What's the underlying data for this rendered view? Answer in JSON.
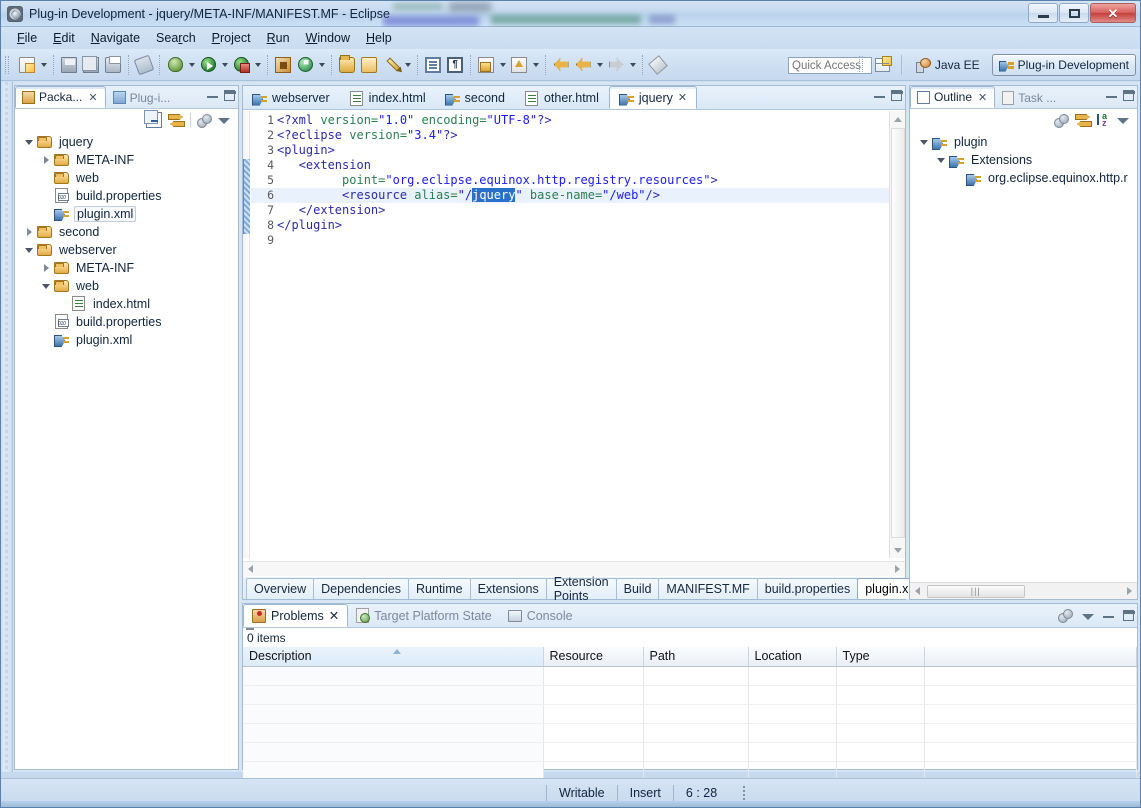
{
  "window": {
    "title": "Plug-in Development - jquery/META-INF/MANIFEST.MF - Eclipse",
    "app_icon": "eclipse-icon",
    "minimize": "minimize-button",
    "maximize": "maximize-button",
    "close": "close-button"
  },
  "menu": {
    "items": [
      {
        "label": "File",
        "mnemonic": "F"
      },
      {
        "label": "Edit",
        "mnemonic": "E"
      },
      {
        "label": "Navigate",
        "mnemonic": "N"
      },
      {
        "label": "Search",
        "mnemonic": "r"
      },
      {
        "label": "Project",
        "mnemonic": "P"
      },
      {
        "label": "Run",
        "mnemonic": "R"
      },
      {
        "label": "Window",
        "mnemonic": "W"
      },
      {
        "label": "Help",
        "mnemonic": "H"
      }
    ]
  },
  "toolbar": {
    "buttons": [
      {
        "name": "new-wizard",
        "icon": "new-document-icon",
        "has_dropdown": true
      },
      {
        "name": "save",
        "icon": "save-icon",
        "has_dropdown": false
      },
      {
        "name": "save-all",
        "icon": "save-all-icon",
        "has_dropdown": false
      },
      {
        "name": "print",
        "icon": "print-icon",
        "has_dropdown": false
      },
      {
        "name": "toggle-mark-occurrences",
        "icon": "mark-occurrences-icon",
        "has_dropdown": false
      },
      {
        "name": "debug",
        "icon": "bug-icon",
        "has_dropdown": true
      },
      {
        "name": "run",
        "icon": "run-icon",
        "has_dropdown": true
      },
      {
        "name": "run-external-tools",
        "icon": "external-tools-icon",
        "has_dropdown": true
      },
      {
        "name": "new-plugin-project",
        "icon": "new-plugin-icon",
        "has_dropdown": false
      },
      {
        "name": "new-target-definition",
        "icon": "target-definition-icon",
        "has_dropdown": true
      },
      {
        "name": "open-type",
        "icon": "open-type-icon",
        "has_dropdown": false
      },
      {
        "name": "open-resource",
        "icon": "open-folder-icon",
        "has_dropdown": false
      },
      {
        "name": "quick-fix",
        "icon": "pencil-icon",
        "has_dropdown": true
      },
      {
        "name": "show-whitespace",
        "icon": "list-box-icon",
        "has_dropdown": false
      },
      {
        "name": "toggle-block-selection",
        "icon": "paragraph-icon",
        "has_dropdown": false
      },
      {
        "name": "next-annotation",
        "icon": "next-annotation-icon",
        "has_dropdown": true
      },
      {
        "name": "previous-annotation",
        "icon": "previous-annotation-icon",
        "has_dropdown": true
      },
      {
        "name": "back-history",
        "icon": "back-arrow-icon",
        "has_dropdown": false
      },
      {
        "name": "back-history-2",
        "icon": "back-arrow-icon",
        "has_dropdown": true
      },
      {
        "name": "forward-history",
        "icon": "forward-arrow-icon",
        "has_dropdown": true
      },
      {
        "name": "ruler",
        "icon": "ruler-icon",
        "has_dropdown": false
      }
    ]
  },
  "quick_access": {
    "placeholder": "Quick Access",
    "value": ""
  },
  "perspectives": {
    "open_perspective_icon": "open-perspective-icon",
    "items": [
      {
        "label": "Java EE",
        "icon": "java-ee-icon",
        "active": false
      },
      {
        "label": "Plug-in Development",
        "icon": "plugin-development-icon",
        "active": true
      }
    ]
  },
  "package_explorer": {
    "tabs": [
      {
        "label": "Packa...",
        "icon": "package-explorer-icon",
        "active": true,
        "closable": true
      },
      {
        "label": "Plug-i...",
        "icon": "plugins-view-icon",
        "active": false,
        "closable": false
      }
    ],
    "toolbar": [
      {
        "name": "collapse-all",
        "icon": "collapse-all-icon"
      },
      {
        "name": "link-with-editor",
        "icon": "link-with-editor-icon"
      },
      {
        "name": "view-menu-balls",
        "icon": "focus-on-active-task-icon"
      },
      {
        "name": "view-menu",
        "icon": "view-menu-icon"
      }
    ],
    "tree": [
      {
        "label": "jquery",
        "icon": "folder-icon",
        "indent": 0,
        "twisty": "expanded",
        "selected": false
      },
      {
        "label": "META-INF",
        "icon": "folder-icon",
        "indent": 1,
        "twisty": "collapsed",
        "selected": false
      },
      {
        "label": "web",
        "icon": "folder-icon",
        "indent": 1,
        "twisty": "none",
        "selected": false
      },
      {
        "label": "build.properties",
        "icon": "properties-file-icon",
        "indent": 1,
        "twisty": "none",
        "selected": false
      },
      {
        "label": "plugin.xml",
        "icon": "plugin-file-icon",
        "indent": 1,
        "twisty": "none",
        "selected": true
      },
      {
        "label": "second",
        "icon": "folder-icon",
        "indent": 0,
        "twisty": "collapsed",
        "selected": false
      },
      {
        "label": "webserver",
        "icon": "folder-icon",
        "indent": 0,
        "twisty": "expanded",
        "selected": false
      },
      {
        "label": "META-INF",
        "icon": "folder-icon",
        "indent": 1,
        "twisty": "collapsed",
        "selected": false
      },
      {
        "label": "web",
        "icon": "folder-icon",
        "indent": 1,
        "twisty": "expanded",
        "selected": false
      },
      {
        "label": "index.html",
        "icon": "html-file-icon",
        "indent": 2,
        "twisty": "none",
        "selected": false
      },
      {
        "label": "build.properties",
        "icon": "properties-file-icon",
        "indent": 1,
        "twisty": "none",
        "selected": false
      },
      {
        "label": "plugin.xml",
        "icon": "plugin-file-icon",
        "indent": 1,
        "twisty": "none",
        "selected": false
      }
    ]
  },
  "editor": {
    "tabs": [
      {
        "label": "webserver",
        "icon": "plugin-file-icon",
        "active": false,
        "closable": false
      },
      {
        "label": "index.html",
        "icon": "html-file-icon",
        "active": false,
        "closable": false
      },
      {
        "label": "second",
        "icon": "plugin-file-icon",
        "active": false,
        "closable": false
      },
      {
        "label": "other.html",
        "icon": "html-file-icon",
        "active": false,
        "closable": false
      },
      {
        "label": "jquery",
        "icon": "plugin-file-icon",
        "active": true,
        "closable": true
      }
    ],
    "code_lines": [
      {
        "n": "1",
        "highlighted": false,
        "tokens": [
          {
            "t": "<?xml ",
            "c": "pi"
          },
          {
            "t": "version=",
            "c": "attr"
          },
          {
            "t": "\"1.0\"",
            "c": "val"
          },
          {
            "t": " ",
            "c": "plain"
          },
          {
            "t": "encoding=",
            "c": "attr"
          },
          {
            "t": "\"UTF-8\"",
            "c": "val"
          },
          {
            "t": "?>",
            "c": "pi"
          }
        ]
      },
      {
        "n": "2",
        "highlighted": false,
        "tokens": [
          {
            "t": "<?eclipse ",
            "c": "pi"
          },
          {
            "t": "version=",
            "c": "attr"
          },
          {
            "t": "\"3.4\"",
            "c": "val"
          },
          {
            "t": "?>",
            "c": "pi"
          }
        ]
      },
      {
        "n": "3",
        "highlighted": false,
        "tokens": [
          {
            "t": "<plugin>",
            "c": "tag"
          }
        ]
      },
      {
        "n": "4",
        "highlighted": false,
        "tokens": [
          {
            "t": "   ",
            "c": "plain"
          },
          {
            "t": "<extension",
            "c": "tag"
          }
        ]
      },
      {
        "n": "5",
        "highlighted": false,
        "tokens": [
          {
            "t": "         ",
            "c": "plain"
          },
          {
            "t": "point=",
            "c": "attr"
          },
          {
            "t": "\"org.eclipse.equinox.http.registry.resources\"",
            "c": "val"
          },
          {
            "t": ">",
            "c": "tag"
          }
        ]
      },
      {
        "n": "6",
        "highlighted": true,
        "tokens": [
          {
            "t": "         ",
            "c": "plain"
          },
          {
            "t": "<resource ",
            "c": "tag"
          },
          {
            "t": "alias=",
            "c": "attr"
          },
          {
            "t": "\"/",
            "c": "val"
          },
          {
            "t": "jquery",
            "c": "sel"
          },
          {
            "t": "\"",
            "c": "val"
          },
          {
            "t": " ",
            "c": "plain"
          },
          {
            "t": "base-name=",
            "c": "attr"
          },
          {
            "t": "\"/web\"",
            "c": "val"
          },
          {
            "t": "/>",
            "c": "tag"
          }
        ]
      },
      {
        "n": "7",
        "highlighted": false,
        "tokens": [
          {
            "t": "   ",
            "c": "plain"
          },
          {
            "t": "</extension>",
            "c": "tag"
          }
        ]
      },
      {
        "n": "8",
        "highlighted": false,
        "tokens": [
          {
            "t": "</plugin>",
            "c": "tag"
          }
        ]
      },
      {
        "n": "9",
        "highlighted": false,
        "tokens": [
          {
            "t": "",
            "c": "plain"
          }
        ]
      }
    ],
    "form_tabs": [
      {
        "label": "Overview",
        "active": false
      },
      {
        "label": "Dependencies",
        "active": false
      },
      {
        "label": "Runtime",
        "active": false
      },
      {
        "label": "Extensions",
        "active": false
      },
      {
        "label": "Extension Points",
        "active": false
      },
      {
        "label": "Build",
        "active": false
      },
      {
        "label": "MANIFEST.MF",
        "active": false
      },
      {
        "label": "build.properties",
        "active": false
      },
      {
        "label": "plugin.xml",
        "active": true
      }
    ]
  },
  "outline": {
    "tabs": [
      {
        "label": "Outline",
        "icon": "outline-icon",
        "active": true,
        "closable": true
      },
      {
        "label": "Task ...",
        "icon": "task-list-icon",
        "active": false,
        "closable": false
      }
    ],
    "toolbar": [
      {
        "name": "focus-active-task",
        "icon": "focus-balls-icon"
      },
      {
        "name": "link-with-editor",
        "icon": "link-with-editor-icon"
      },
      {
        "name": "sort",
        "icon": "sort-az-icon"
      },
      {
        "name": "view-menu",
        "icon": "view-menu-icon"
      }
    ],
    "tree": [
      {
        "label": "plugin",
        "icon": "plugin-node-icon",
        "indent": 0,
        "twisty": "expanded"
      },
      {
        "label": "Extensions",
        "icon": "extensions-node-icon",
        "indent": 1,
        "twisty": "expanded"
      },
      {
        "label": "org.eclipse.equinox.http.r",
        "icon": "extension-point-icon",
        "indent": 2,
        "twisty": "none"
      }
    ]
  },
  "problems": {
    "tabs": [
      {
        "label": "Problems",
        "icon": "problems-icon",
        "active": true,
        "closable": true
      },
      {
        "label": "Target Platform State",
        "icon": "target-platform-icon",
        "active": false,
        "closable": false
      },
      {
        "label": "Console",
        "icon": "console-icon",
        "active": false,
        "closable": false
      }
    ],
    "toolbar": [
      {
        "name": "focus-active-task",
        "icon": "focus-balls-icon"
      },
      {
        "name": "view-menu",
        "icon": "view-menu-icon"
      },
      {
        "name": "minimize",
        "icon": "minimize-icon"
      },
      {
        "name": "maximize",
        "icon": "maximize-icon"
      }
    ],
    "items_count": "0 items",
    "columns": [
      {
        "label": "Description",
        "sorted": true
      },
      {
        "label": "Resource",
        "sorted": false
      },
      {
        "label": "Path",
        "sorted": false
      },
      {
        "label": "Location",
        "sorted": false
      },
      {
        "label": "Type",
        "sorted": false
      }
    ],
    "rows": []
  },
  "status_bar": {
    "writable": "Writable",
    "insert_mode": "Insert",
    "cursor_position": "6 : 28"
  },
  "colors": {
    "accent": "#2a6fc9",
    "chrome": "#cfe0f2",
    "selection": "#2a6fc9",
    "line_highlight": "#e8f1fc"
  }
}
